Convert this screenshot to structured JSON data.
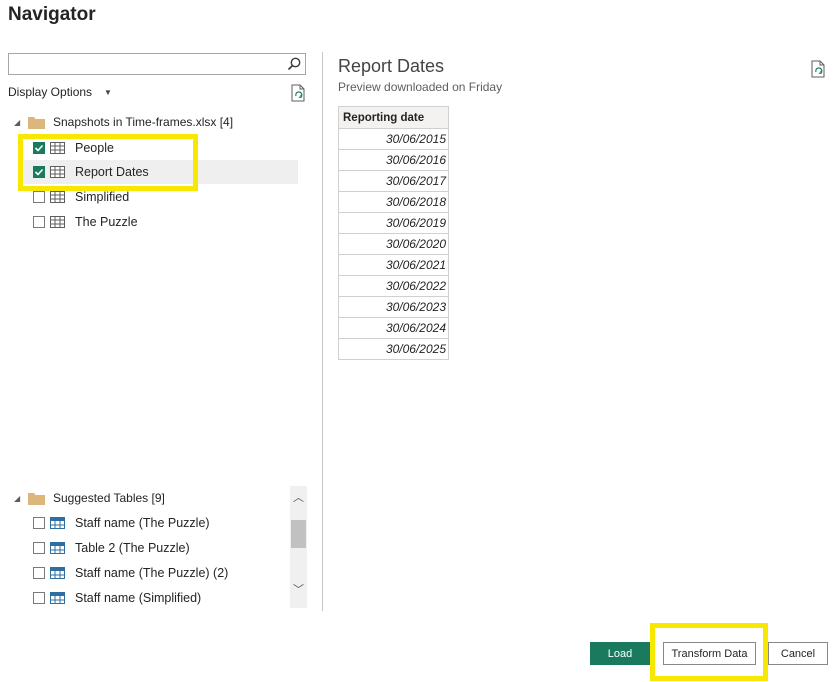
{
  "window": {
    "title": "Navigator"
  },
  "left_panel": {
    "search": {
      "value": "",
      "placeholder": ""
    },
    "display_options_label": "Display Options",
    "source": {
      "label": "Snapshots in Time-frames.xlsx [4]",
      "items": [
        {
          "label": "People",
          "checked": true
        },
        {
          "label": "Report Dates",
          "checked": true,
          "selected": true
        },
        {
          "label": "Simplified",
          "checked": false
        },
        {
          "label": "The Puzzle",
          "checked": false
        }
      ]
    },
    "suggested": {
      "label": "Suggested Tables [9]",
      "items": [
        {
          "label": "Staff name (The Puzzle)",
          "checked": false
        },
        {
          "label": "Table 2 (The Puzzle)",
          "checked": false
        },
        {
          "label": "Staff name (The Puzzle) (2)",
          "checked": false
        },
        {
          "label": "Staff name (Simplified)",
          "checked": false
        }
      ]
    }
  },
  "preview": {
    "title": "Report Dates",
    "subtitle": "Preview downloaded on Friday",
    "column_header": "Reporting date",
    "rows": [
      "30/06/2015",
      "30/06/2016",
      "30/06/2017",
      "30/06/2018",
      "30/06/2019",
      "30/06/2020",
      "30/06/2021",
      "30/06/2022",
      "30/06/2023",
      "30/06/2024",
      "30/06/2025"
    ]
  },
  "footer": {
    "load_label": "Load",
    "transform_label": "Transform Data",
    "cancel_label": "Cancel"
  },
  "colors": {
    "accent": "#1a7a5e",
    "highlight": "#f8e700",
    "folder": "#dcb67a"
  }
}
